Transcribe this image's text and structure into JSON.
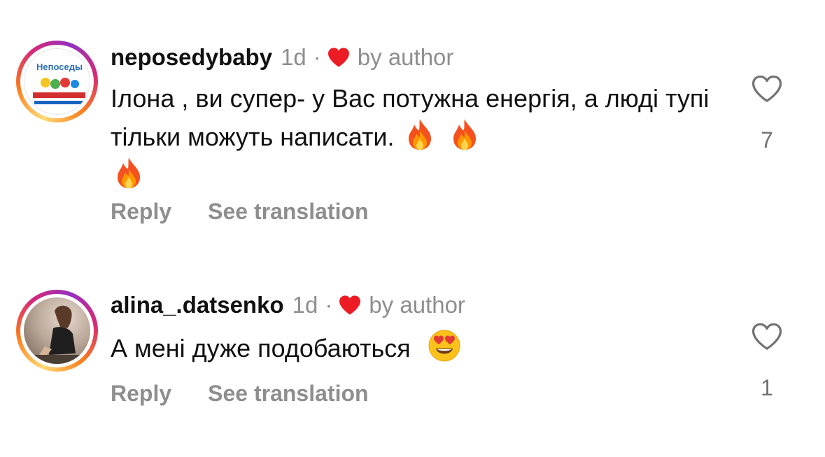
{
  "colors": {
    "heart_red": "#ed1c24",
    "meta_gray": "#8e8e8e",
    "text": "#111111"
  },
  "comments": [
    {
      "username": "neposedybaby",
      "time": "1d",
      "separator": "·",
      "liked_by_author_icon": "heart-icon",
      "by_author": "by author",
      "text": "Ілона , ви супер- у Вас потужна енергія, а люді тупі тільки можуть написати.",
      "emojis": [
        "fire",
        "fire",
        "fire"
      ],
      "avatar_text": "Непоседы",
      "reply_label": "Reply",
      "translate_label": "See translation",
      "like_count": "7"
    },
    {
      "username": "alina_.datsenko",
      "time": "1d",
      "separator": "·",
      "liked_by_author_icon": "heart-icon",
      "by_author": "by author",
      "text": "А мені дуже подобаються",
      "emojis": [
        "smiling-face-with-heart-eyes"
      ],
      "reply_label": "Reply",
      "translate_label": "See translation",
      "like_count": "1"
    }
  ]
}
